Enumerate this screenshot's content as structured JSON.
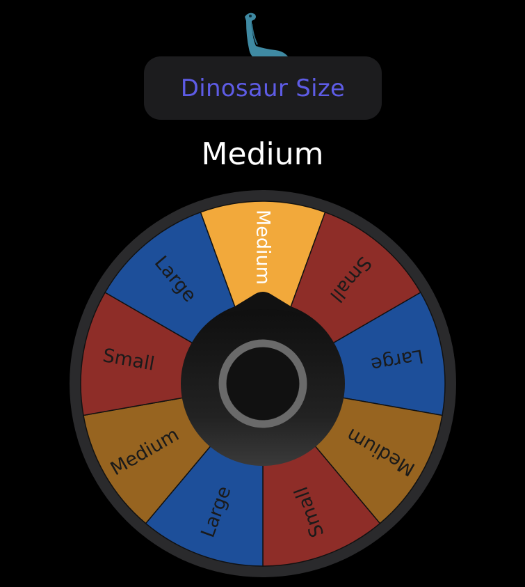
{
  "header": {
    "title": "Dinosaur Size",
    "dino_icon": "brachiosaurus-icon"
  },
  "result": {
    "value": "Medium"
  },
  "wheel": {
    "pointer_icon": "spinner-pointer-icon",
    "segments": [
      {
        "label": "Medium",
        "color": "#f2a93b",
        "text_color": "#ffffff"
      },
      {
        "label": "Small",
        "color": "#8e2d28",
        "text_color": "#1a1a1a"
      },
      {
        "label": "Large",
        "color": "#1d4f9a",
        "text_color": "#1a1a1a"
      },
      {
        "label": "Medium",
        "color": "#976420",
        "text_color": "#1a1a1a"
      },
      {
        "label": "Small",
        "color": "#8e2d28",
        "text_color": "#1a1a1a"
      },
      {
        "label": "Large",
        "color": "#1d4f9a",
        "text_color": "#1a1a1a"
      },
      {
        "label": "Medium",
        "color": "#976420",
        "text_color": "#1a1a1a"
      },
      {
        "label": "Small",
        "color": "#8e2d28",
        "text_color": "#1a1a1a"
      },
      {
        "label": "Large",
        "color": "#1d4f9a",
        "text_color": "#1a1a1a"
      }
    ]
  }
}
